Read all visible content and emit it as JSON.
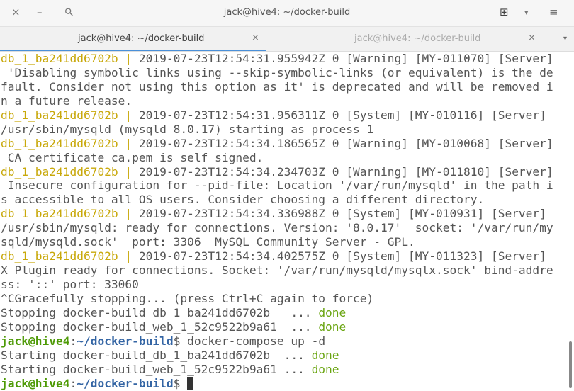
{
  "window": {
    "title": "jack@hive4: ~/docker-build"
  },
  "tabs": [
    {
      "label": "jack@hive4: ~/docker-build",
      "active": true
    },
    {
      "label": "jack@hive4: ~/docker-build",
      "active": false
    }
  ],
  "icons": {
    "close": "×",
    "minimize": "–",
    "search": "⚲",
    "new_tab": "⊞",
    "dropdown": "▾",
    "menu": "≡",
    "tab_close": "×"
  },
  "colors": {
    "db_prefix": "#c8a80a",
    "done": "#6aa511",
    "prompt_user": "#4e9a06",
    "prompt_path": "#3465a4"
  },
  "terminal": {
    "lines": [
      [
        {
          "t": "db_1_ba241dd6702b | ",
          "c": "db"
        },
        {
          "t": "2019-07-23T12:54:31.955942Z 0 [Warning] [MY-011070] [Server]"
        }
      ],
      [
        {
          "t": " 'Disabling symbolic links using --skip-symbolic-links (or equivalent) is the de"
        }
      ],
      [
        {
          "t": "fault. Consider not using this option as it' is deprecated and will be removed i"
        }
      ],
      [
        {
          "t": "n a future release."
        }
      ],
      [
        {
          "t": "db_1_ba241dd6702b | ",
          "c": "db"
        },
        {
          "t": "2019-07-23T12:54:31.956311Z 0 [System] [MY-010116] [Server]"
        }
      ],
      [
        {
          "t": "/usr/sbin/mysqld (mysqld 8.0.17) starting as process 1"
        }
      ],
      [
        {
          "t": "db_1_ba241dd6702b | ",
          "c": "db"
        },
        {
          "t": "2019-07-23T12:54:34.186565Z 0 [Warning] [MY-010068] [Server]"
        }
      ],
      [
        {
          "t": " CA certificate ca.pem is self signed."
        }
      ],
      [
        {
          "t": "db_1_ba241dd6702b | ",
          "c": "db"
        },
        {
          "t": "2019-07-23T12:54:34.234703Z 0 [Warning] [MY-011810] [Server]"
        }
      ],
      [
        {
          "t": " Insecure configuration for --pid-file: Location '/var/run/mysqld' in the path i"
        }
      ],
      [
        {
          "t": "s accessible to all OS users. Consider choosing a different directory."
        }
      ],
      [
        {
          "t": "db_1_ba241dd6702b | ",
          "c": "db"
        },
        {
          "t": "2019-07-23T12:54:34.336988Z 0 [System] [MY-010931] [Server]"
        }
      ],
      [
        {
          "t": "/usr/sbin/mysqld: ready for connections. Version: '8.0.17'  socket: '/var/run/my"
        }
      ],
      [
        {
          "t": "sqld/mysqld.sock'  port: 3306  MySQL Community Server - GPL."
        }
      ],
      [
        {
          "t": "db_1_ba241dd6702b | ",
          "c": "db"
        },
        {
          "t": "2019-07-23T12:54:34.402575Z 0 [System] [MY-011323] [Server]"
        }
      ],
      [
        {
          "t": "X Plugin ready for connections. Socket: '/var/run/mysqld/mysqlx.sock' bind-addre"
        }
      ],
      [
        {
          "t": "ss: '::' port: 33060"
        }
      ],
      [
        {
          "t": "^CGracefully stopping... (press Ctrl+C again to force)"
        }
      ],
      [
        {
          "t": "Stopping docker-build_db_1_ba241dd6702b   ... "
        },
        {
          "t": "done",
          "c": "done"
        }
      ],
      [
        {
          "t": "Stopping docker-build_web_1_52c9522b9a61  ... "
        },
        {
          "t": "done",
          "c": "done"
        }
      ],
      [
        {
          "t": "jack@hive4",
          "c": "user"
        },
        {
          "t": ":"
        },
        {
          "t": "~/docker-build",
          "c": "path"
        },
        {
          "t": "$ docker-compose up -d"
        }
      ],
      [
        {
          "t": "Starting docker-build_db_1_ba241dd6702b  ... "
        },
        {
          "t": "done",
          "c": "done"
        }
      ],
      [
        {
          "t": "Starting docker-build_web_1_52c9522b9a61 ... "
        },
        {
          "t": "done",
          "c": "done"
        }
      ],
      [
        {
          "t": "jack@hive4",
          "c": "user"
        },
        {
          "t": ":"
        },
        {
          "t": "~/docker-build",
          "c": "path"
        },
        {
          "t": "$ "
        },
        {
          "cursor": true
        }
      ]
    ]
  }
}
